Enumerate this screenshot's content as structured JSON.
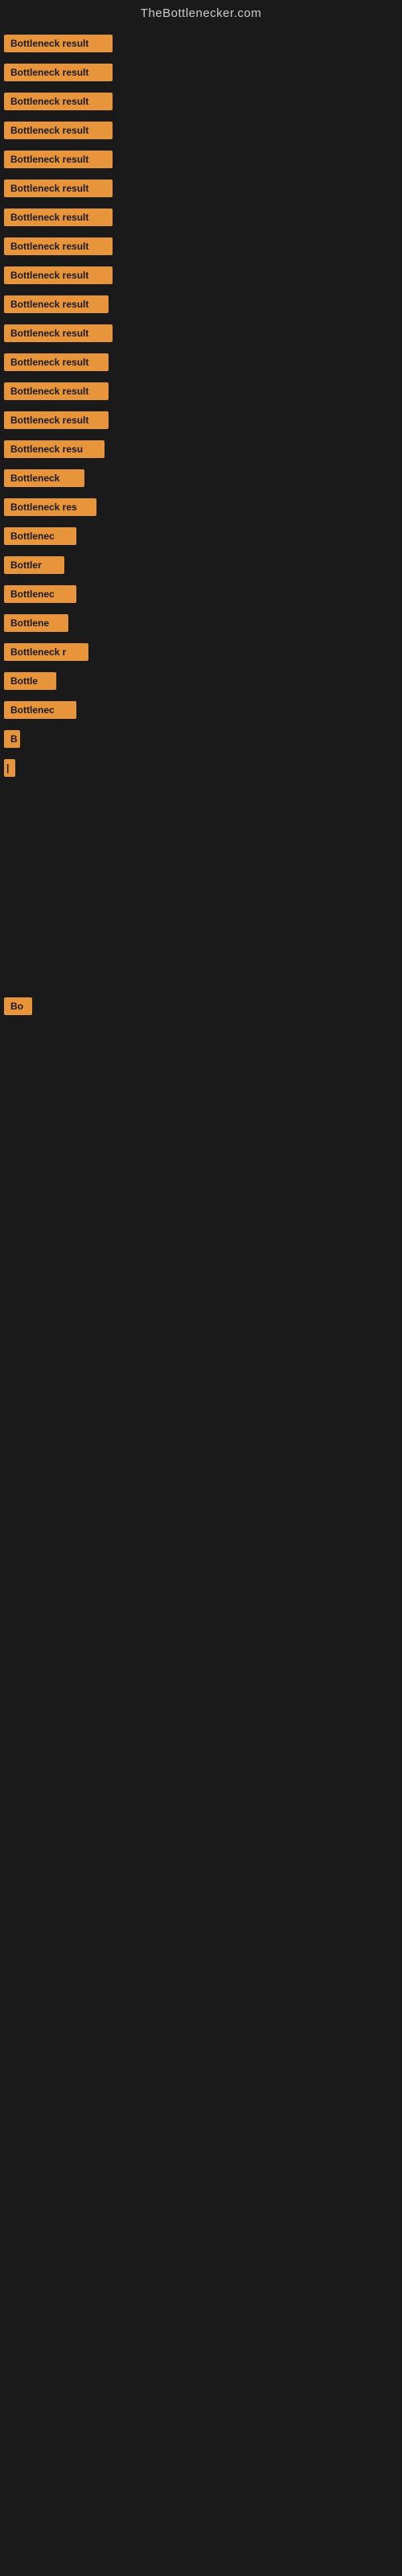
{
  "site": {
    "title": "TheBottlenecker.com"
  },
  "items": [
    {
      "id": 1,
      "label": "Bottleneck result"
    },
    {
      "id": 2,
      "label": "Bottleneck result"
    },
    {
      "id": 3,
      "label": "Bottleneck result"
    },
    {
      "id": 4,
      "label": "Bottleneck result"
    },
    {
      "id": 5,
      "label": "Bottleneck result"
    },
    {
      "id": 6,
      "label": "Bottleneck result"
    },
    {
      "id": 7,
      "label": "Bottleneck result"
    },
    {
      "id": 8,
      "label": "Bottleneck result"
    },
    {
      "id": 9,
      "label": "Bottleneck result"
    },
    {
      "id": 10,
      "label": "Bottleneck result"
    },
    {
      "id": 11,
      "label": "Bottleneck result"
    },
    {
      "id": 12,
      "label": "Bottleneck result"
    },
    {
      "id": 13,
      "label": "Bottleneck result"
    },
    {
      "id": 14,
      "label": "Bottleneck result"
    },
    {
      "id": 15,
      "label": "Bottleneck resu"
    },
    {
      "id": 16,
      "label": "Bottleneck"
    },
    {
      "id": 17,
      "label": "Bottleneck res"
    },
    {
      "id": 18,
      "label": "Bottlenec"
    },
    {
      "id": 19,
      "label": "Bottler"
    },
    {
      "id": 20,
      "label": "Bottlenec"
    },
    {
      "id": 21,
      "label": "Bottlene"
    },
    {
      "id": 22,
      "label": "Bottleneck r"
    },
    {
      "id": 23,
      "label": "Bottle"
    },
    {
      "id": 24,
      "label": "Bottlenec"
    },
    {
      "id": 25,
      "label": "B"
    },
    {
      "id": 26,
      "label": "|"
    },
    {
      "id": 27,
      "label": "Bo"
    }
  ]
}
